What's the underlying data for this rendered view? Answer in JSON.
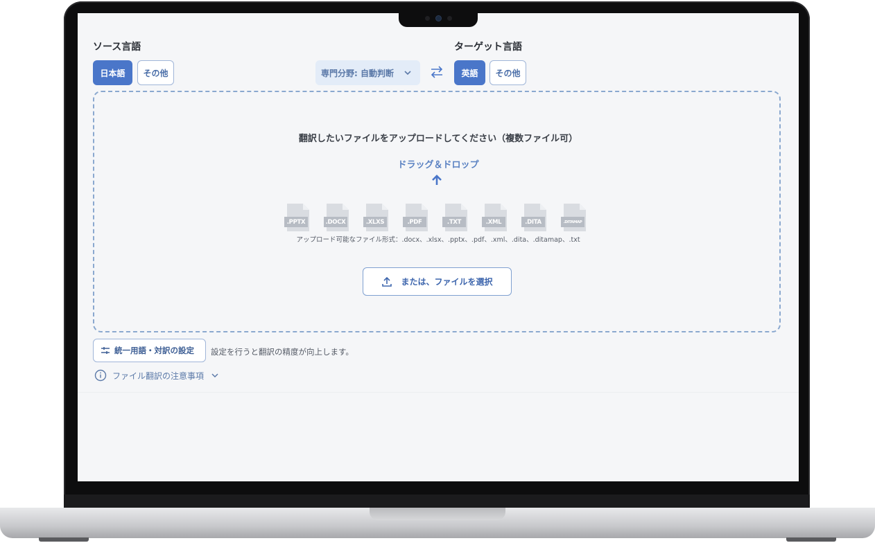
{
  "source": {
    "label": "ソース言語",
    "buttons": [
      {
        "label": "日本語",
        "selected": true
      },
      {
        "label": "その他",
        "selected": false
      }
    ]
  },
  "domain_select": {
    "value": "専門分野: 自動判断"
  },
  "target": {
    "label": "ターゲット言語",
    "buttons": [
      {
        "label": "英語",
        "selected": true
      },
      {
        "label": "その他",
        "selected": false
      }
    ]
  },
  "upload": {
    "heading": "翻訳したいファイルをアップロードしてください（複数ファイル可）",
    "drag_drop": "ドラッグ＆ドロップ",
    "file_types": [
      ".PPTX",
      ".DOCX",
      ".XLXS",
      ".PDF",
      ".TXT",
      ".XML",
      ".DITA",
      ".DITAMAP"
    ],
    "formats_text": "アップロード可能なファイル形式：.docx、.xlsx、.pptx、.pdf、.xml、.dita、.ditamap、.txt",
    "choose_button": "または、ファイルを選択"
  },
  "glossary": {
    "button": "統一用語・対訳の設定",
    "note": "設定を行うと翻訳の精度が向上します。"
  },
  "notes": {
    "label": "ファイル翻訳の注意事項"
  },
  "colors": {
    "accent": "#4a76c9",
    "link": "#5b82c2",
    "dashed_border": "#8aa8cf"
  }
}
